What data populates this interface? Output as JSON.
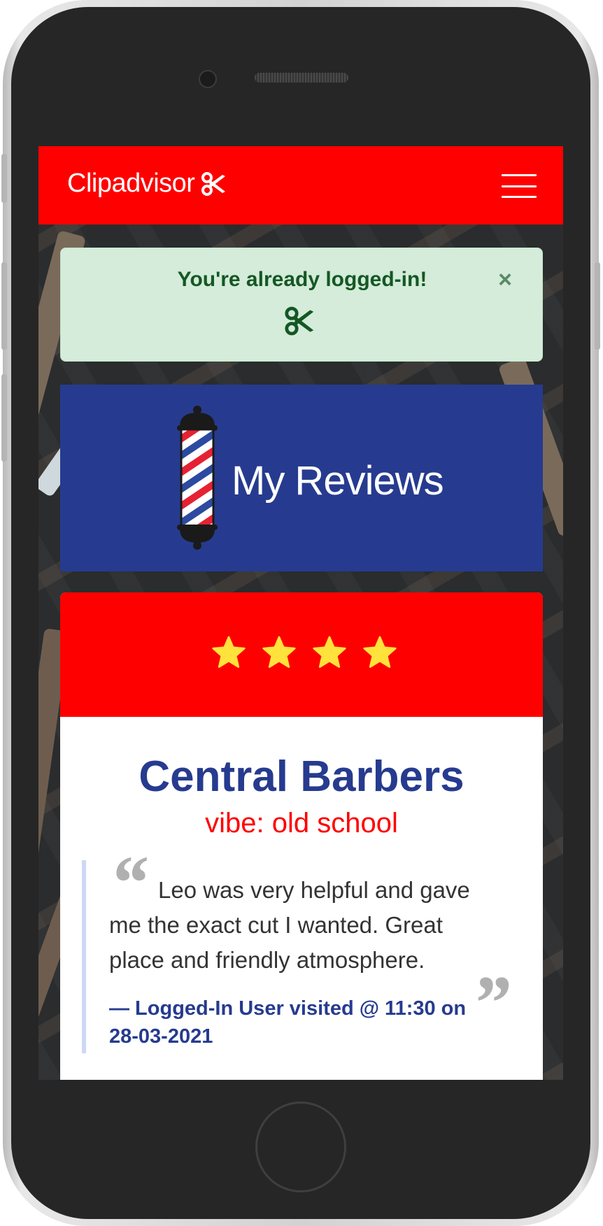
{
  "navbar": {
    "brand": "Clipadvisor",
    "brand_icon": "scissors-icon",
    "menu_icon": "hamburger-menu-icon"
  },
  "alert": {
    "message": "You're already logged-in!",
    "icon": "scissors-icon",
    "close_label": "×"
  },
  "page_header": {
    "title": "My Reviews",
    "icon": "barber-pole-icon"
  },
  "review": {
    "rating": 4,
    "rating_max": 4,
    "star_color": "#ffe23b",
    "shop_name": "Central Barbers",
    "vibe": "vibe: old school",
    "quote": "Leo was very helpful and gave me the exact cut I wanted. Great place and friendly atmosphere.",
    "author": "— Logged-In User visited @ 11:30 on 28-03-2021"
  },
  "colors": {
    "brand_red": "#ff0000",
    "brand_blue": "#263b8f",
    "alert_green": "#155724",
    "alert_bg": "#d4ecd9"
  }
}
